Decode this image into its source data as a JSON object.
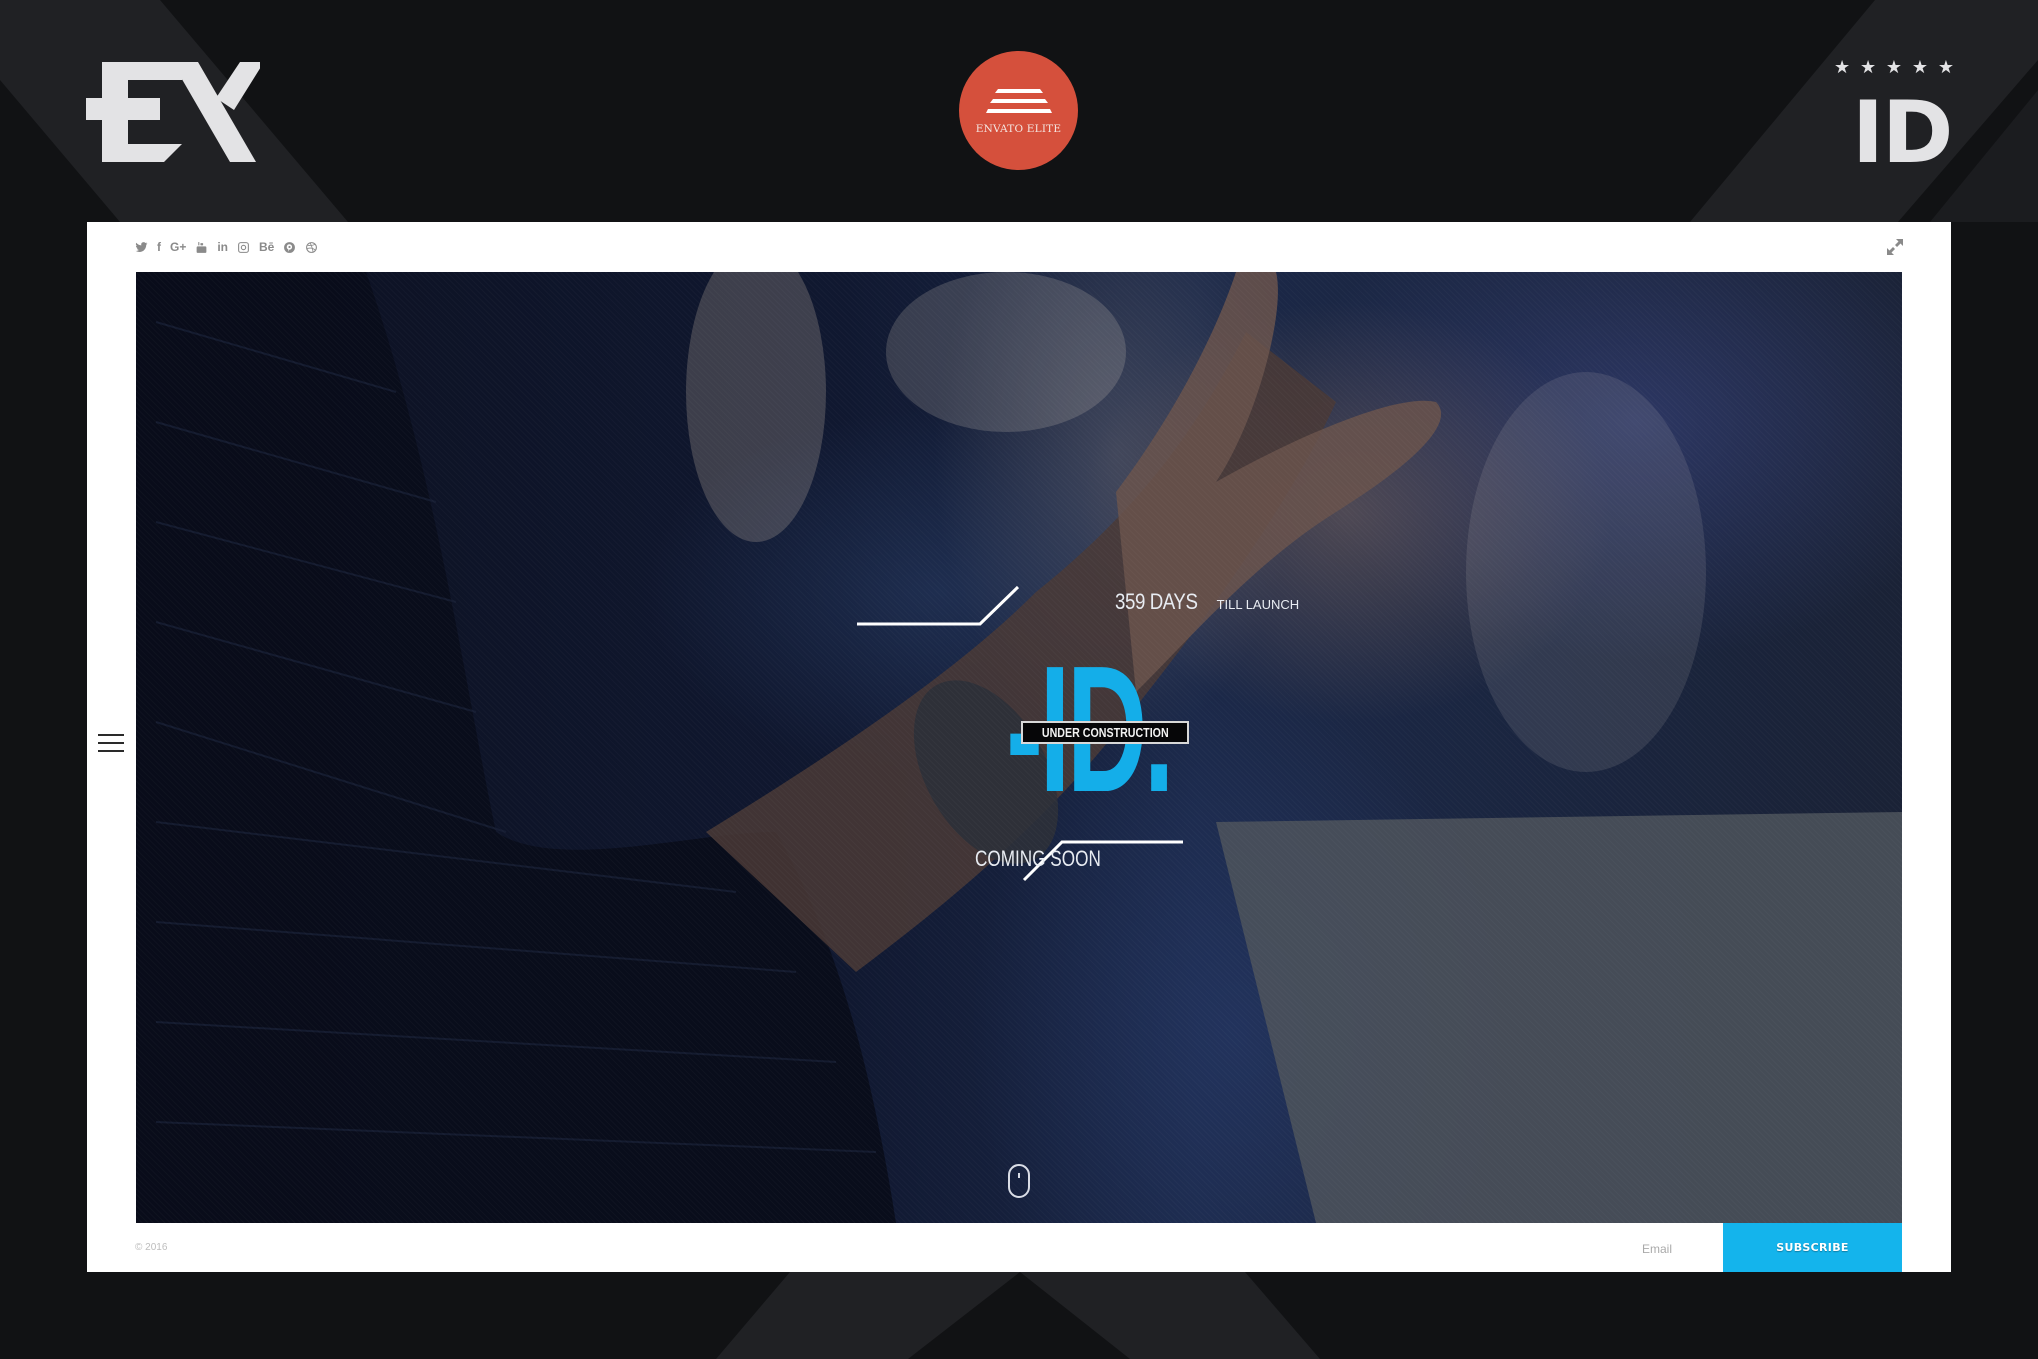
{
  "branding": {
    "left_logo": "EX",
    "badge_label": "ENVATO ELITE",
    "badge_color": "#d5503c",
    "rating_stars": 5,
    "right_logo": "ID"
  },
  "social": {
    "icons": [
      "twitter-icon",
      "facebook-icon",
      "google-plus-icon",
      "youtube-icon",
      "linkedin-icon",
      "instagram-icon",
      "behance-icon",
      "pinterest-icon",
      "dribbble-icon"
    ],
    "labels": {
      "facebook": "f",
      "google_plus": "G+",
      "linkedin": "in",
      "behance": "Bē"
    }
  },
  "hero": {
    "countdown_number": "359 DAYS",
    "countdown_suffix": "TILL LAUNCH",
    "logo_text": "-ID.",
    "status_badge": "UNDER CONSTRUCTION",
    "tagline": "COMING SOON",
    "accent_color": "#14aee9"
  },
  "footer": {
    "copyright": "© 2016",
    "email_placeholder": "Email",
    "subscribe_label": "SUBSCRIBE",
    "subscribe_color": "#14b4ec"
  }
}
